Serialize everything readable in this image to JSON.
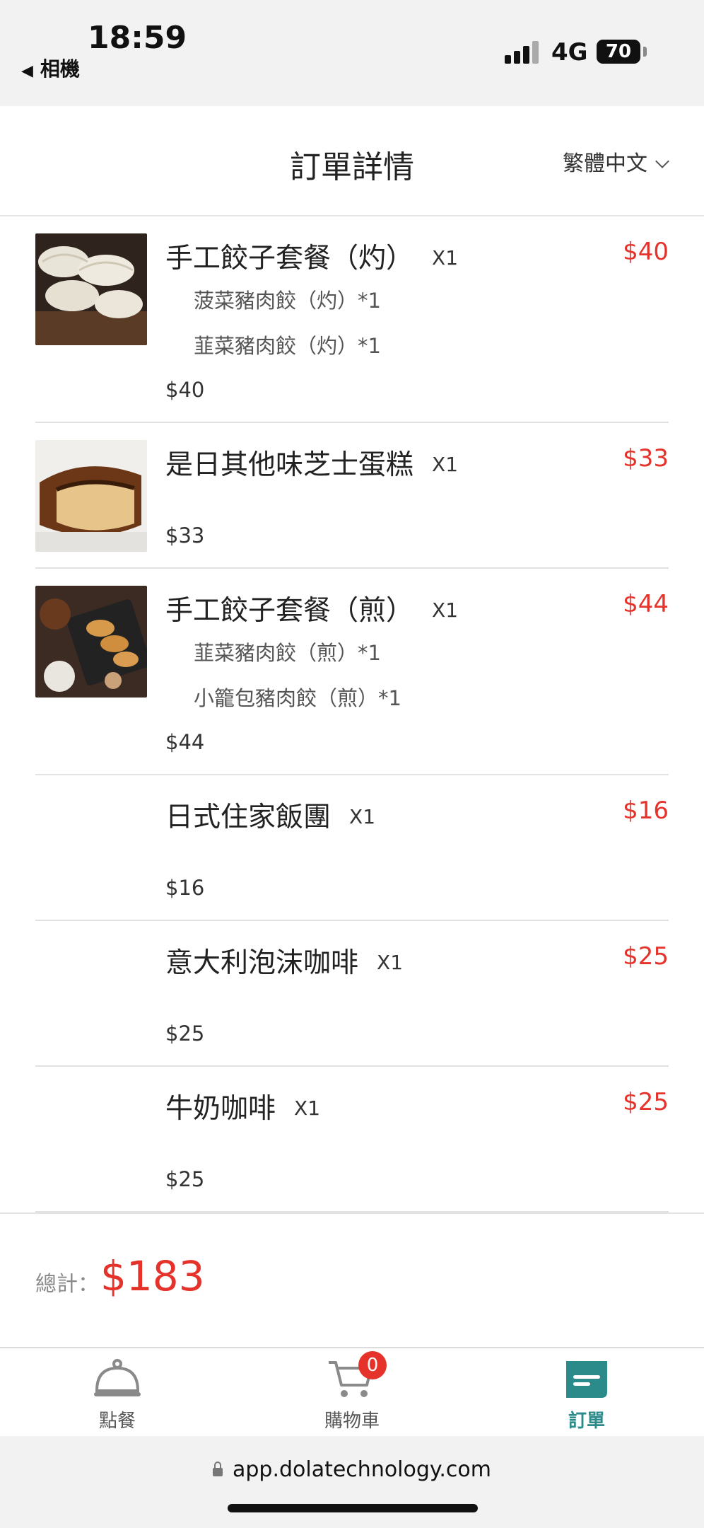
{
  "status": {
    "time": "18:59",
    "back_label": "相機",
    "network": "4G",
    "battery": "70"
  },
  "header": {
    "title": "訂單詳情",
    "language": "繁體中文"
  },
  "colors": {
    "accent_red": "#e5322b",
    "active_teal": "#2b8a8a"
  },
  "items": [
    {
      "name": "手工餃子套餐（灼）",
      "qty": "X1",
      "price": "$40",
      "subs": [
        "菠菜豬肉餃（灼）*1",
        "韮菜豬肉餃（灼）*1"
      ],
      "price_bottom": "$40",
      "image": "dumplings-boiled"
    },
    {
      "name": "是日其他味芝士蛋糕",
      "qty": "X1",
      "price": "$33",
      "subs": [],
      "price_bottom": "$33",
      "image": "cheesecake"
    },
    {
      "name": "手工餃子套餐（煎）",
      "qty": "X1",
      "price": "$44",
      "subs": [
        "韮菜豬肉餃（煎）*1",
        "小籠包豬肉餃（煎）*1"
      ],
      "price_bottom": "$44",
      "image": "dumplings-fried"
    },
    {
      "name": "日式住家飯團",
      "qty": "X1",
      "price": "$16",
      "subs": [],
      "price_bottom": "$16"
    },
    {
      "name": "意大利泡沫咖啡",
      "qty": "X1",
      "price": "$25",
      "subs": [],
      "price_bottom": "$25"
    },
    {
      "name": "牛奶咖啡",
      "qty": "X1",
      "price": "$25",
      "subs": [],
      "price_bottom": "$25"
    }
  ],
  "total": {
    "label": "總計：",
    "value": "$183"
  },
  "tabs": [
    {
      "label": "點餐",
      "icon": "cloche-icon"
    },
    {
      "label": "購物車",
      "icon": "cart-icon",
      "badge": "0"
    },
    {
      "label": "訂單",
      "icon": "order-icon",
      "active": true
    }
  ],
  "browser": {
    "url": "app.dolatechnology.com"
  }
}
